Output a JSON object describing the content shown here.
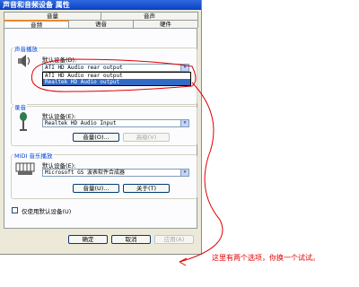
{
  "window": {
    "title": "声音和音频设备 属性",
    "tabs_back": [
      "音量",
      "音声"
    ],
    "tabs_front": [
      "音频",
      "语音",
      "硬件"
    ]
  },
  "playback": {
    "title": "声音播放",
    "default_label": "默认设备(D):",
    "selected": "ATI HD Audio rear output",
    "options": [
      "ATI HD Audio rear output",
      "Realtek HD Audio output"
    ]
  },
  "recording": {
    "title": "录音",
    "default_label": "默认设备(E):",
    "selected": "Realtek HD Audio Input",
    "volume_button": "音量(O)...",
    "advanced_button": "高级(V)"
  },
  "midi": {
    "title": "MIDI 音乐播放",
    "default_label": "默认设备(E):",
    "selected": "Microsoft GS 波表软件合成器",
    "volume_button": "音量(U)...",
    "about_button": "关于(T)"
  },
  "default_only_label": "仅使用默认设备(U)",
  "buttons": {
    "ok": "确定",
    "cancel": "取消",
    "apply": "应用(A)"
  },
  "annotation": "这里有两个选项，你换一个试试。"
}
